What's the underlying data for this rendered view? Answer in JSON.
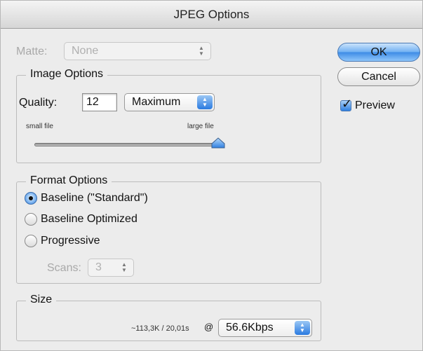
{
  "window": {
    "title": "JPEG Options"
  },
  "matte": {
    "label": "Matte:",
    "value": "None"
  },
  "image_options": {
    "title": "Image Options",
    "quality_label": "Quality:",
    "quality_value": "12",
    "quality_preset": "Maximum",
    "small_label": "small file",
    "large_label": "large file",
    "slider_level": 1.0
  },
  "format_options": {
    "title": "Format Options",
    "options": [
      "Baseline (\"Standard\")",
      "Baseline Optimized",
      "Progressive"
    ],
    "selected_index": 0,
    "scans_label": "Scans:",
    "scans_value": "3"
  },
  "size": {
    "title": "Size",
    "estimate": "~113,3K / 20,01s",
    "at": "@",
    "speed": "56.6Kbps"
  },
  "buttons": {
    "ok": "OK",
    "cancel": "Cancel"
  },
  "preview": {
    "label": "Preview",
    "checked": true
  },
  "colors": {
    "accent": "#2f7fe0",
    "background": "#ececec"
  }
}
